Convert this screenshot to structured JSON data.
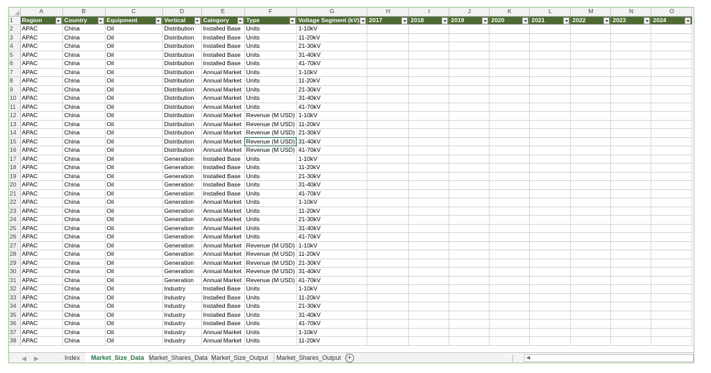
{
  "columns": [
    "A",
    "B",
    "C",
    "D",
    "E",
    "F",
    "G",
    "H",
    "I",
    "J",
    "K",
    "L",
    "M",
    "N",
    "O"
  ],
  "headers": [
    "Region",
    "Country",
    "Equipment",
    "Vertical",
    "Category",
    "Type",
    "Voltage Segment (kV)",
    "2017",
    "2018",
    "2019",
    "2020",
    "2021",
    "2022",
    "2023",
    "2024"
  ],
  "rows": [
    [
      "APAC",
      "China",
      "Oil",
      "Distribution",
      "Installed Base",
      "Units",
      "1-10kV"
    ],
    [
      "APAC",
      "China",
      "Oil",
      "Distribution",
      "Installed Base",
      "Units",
      "11-20kV"
    ],
    [
      "APAC",
      "China",
      "Oil",
      "Distribution",
      "Installed Base",
      "Units",
      "21-30kV"
    ],
    [
      "APAC",
      "China",
      "Oil",
      "Distribution",
      "Installed Base",
      "Units",
      "31-40kV"
    ],
    [
      "APAC",
      "China",
      "Oil",
      "Distribution",
      "Installed Base",
      "Units",
      "41-70kV"
    ],
    [
      "APAC",
      "China",
      "Oil",
      "Distribution",
      "Annual Market",
      "Units",
      "1-10kV"
    ],
    [
      "APAC",
      "China",
      "Oil",
      "Distribution",
      "Annual Market",
      "Units",
      "11-20kV"
    ],
    [
      "APAC",
      "China",
      "Oil",
      "Distribution",
      "Annual Market",
      "Units",
      "21-30kV"
    ],
    [
      "APAC",
      "China",
      "Oil",
      "Distribution",
      "Annual Market",
      "Units",
      "31-40kV"
    ],
    [
      "APAC",
      "China",
      "Oil",
      "Distribution",
      "Annual Market",
      "Units",
      "41-70kV"
    ],
    [
      "APAC",
      "China",
      "Oil",
      "Distribution",
      "Annual Market",
      "Revenue (M USD)",
      "1-10kV"
    ],
    [
      "APAC",
      "China",
      "Oil",
      "Distribution",
      "Annual Market",
      "Revenue (M USD)",
      "11-20kV"
    ],
    [
      "APAC",
      "China",
      "Oil",
      "Distribution",
      "Annual Market",
      "Revenue (M USD)",
      "21-30kV"
    ],
    [
      "APAC",
      "China",
      "Oil",
      "Distribution",
      "Annual Market",
      "Revenue (M USD)",
      "31-40kV"
    ],
    [
      "APAC",
      "China",
      "Oil",
      "Distribution",
      "Annual Market",
      "Revenue (M USD)",
      "41-70kV"
    ],
    [
      "APAC",
      "China",
      "Oil",
      "Generation",
      "Installed Base",
      "Units",
      "1-10kV"
    ],
    [
      "APAC",
      "China",
      "Oil",
      "Generation",
      "Installed Base",
      "Units",
      "11-20kV"
    ],
    [
      "APAC",
      "China",
      "Oil",
      "Generation",
      "Installed Base",
      "Units",
      "21-30kV"
    ],
    [
      "APAC",
      "China",
      "Oil",
      "Generation",
      "Installed Base",
      "Units",
      "31-40kV"
    ],
    [
      "APAC",
      "China",
      "Oil",
      "Generation",
      "Installed Base",
      "Units",
      "41-70kV"
    ],
    [
      "APAC",
      "China",
      "Oil",
      "Generation",
      "Annual Market",
      "Units",
      "1-10kV"
    ],
    [
      "APAC",
      "China",
      "Oil",
      "Generation",
      "Annual Market",
      "Units",
      "11-20kV"
    ],
    [
      "APAC",
      "China",
      "Oil",
      "Generation",
      "Annual Market",
      "Units",
      "21-30kV"
    ],
    [
      "APAC",
      "China",
      "Oil",
      "Generation",
      "Annual Market",
      "Units",
      "31-40kV"
    ],
    [
      "APAC",
      "China",
      "Oil",
      "Generation",
      "Annual Market",
      "Units",
      "41-70kV"
    ],
    [
      "APAC",
      "China",
      "Oil",
      "Generation",
      "Annual Market",
      "Revenue (M USD)",
      "1-10kV"
    ],
    [
      "APAC",
      "China",
      "Oil",
      "Generation",
      "Annual Market",
      "Revenue (M USD)",
      "11-20kV"
    ],
    [
      "APAC",
      "China",
      "Oil",
      "Generation",
      "Annual Market",
      "Revenue (M USD)",
      "21-30kV"
    ],
    [
      "APAC",
      "China",
      "Oil",
      "Generation",
      "Annual Market",
      "Revenue (M USD)",
      "31-40kV"
    ],
    [
      "APAC",
      "China",
      "Oil",
      "Generation",
      "Annual Market",
      "Revenue (M USD)",
      "41-70kV"
    ],
    [
      "APAC",
      "China",
      "Oil",
      "Industry",
      "Installed Base",
      "Units",
      "1-10kV"
    ],
    [
      "APAC",
      "China",
      "Oil",
      "Industry",
      "Installed Base",
      "Units",
      "11-20kV"
    ],
    [
      "APAC",
      "China",
      "Oil",
      "Industry",
      "Installed Base",
      "Units",
      "21-30kV"
    ],
    [
      "APAC",
      "China",
      "Oil",
      "Industry",
      "Installed Base",
      "Units",
      "31-40kV"
    ],
    [
      "APAC",
      "China",
      "Oil",
      "Industry",
      "Installed Base",
      "Units",
      "41-70kV"
    ],
    [
      "APAC",
      "China",
      "Oil",
      "Industry",
      "Annual Market",
      "Units",
      "1-10kV"
    ],
    [
      "APAC",
      "China",
      "Oil",
      "Industry",
      "Annual Market",
      "Units",
      "11-20kV"
    ]
  ],
  "selected_cell": "F15",
  "sheet_tabs": [
    "Index",
    "Market_Size_Data",
    "Market_Shares_Data",
    "Market_Size_Output",
    "Market_Shares_Output"
  ],
  "active_tab": "Market_Size_Data",
  "nav": {
    "prev": "◀",
    "next": "▶"
  },
  "add_sheet_symbol": "+",
  "scroll_left_arrow": "◀",
  "colors": {
    "header_fill": "#4e6b34",
    "header_text": "#ffffff",
    "active_tab_text": "#217346",
    "gridline": "#d4d4d4"
  },
  "icons": {
    "filter": "filter-dropdown-icon",
    "add_sheet": "plus-circle-icon",
    "select_all": "select-all-triangle-icon"
  }
}
